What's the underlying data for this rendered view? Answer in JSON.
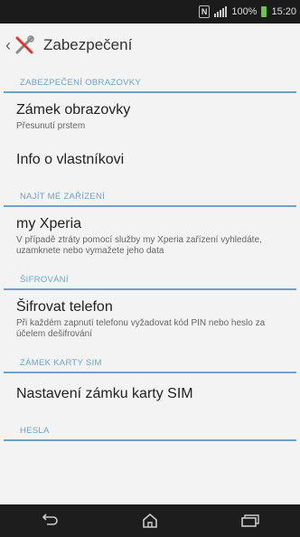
{
  "status_bar": {
    "nfc": "N",
    "battery": "100%",
    "time": "15:20"
  },
  "action_bar": {
    "title": "Zabezpečení",
    "back_icon": "chevron-left-icon",
    "app_icon": "security-tools-icon"
  },
  "sections": [
    {
      "header": "ZABEZPEČENÍ OBRAZOVKY",
      "items": [
        {
          "title": "Zámek obrazovky",
          "subtitle": "Přesunutí prstem"
        },
        {
          "title": "Info o vlastníkovi",
          "subtitle": ""
        }
      ]
    },
    {
      "header": "NAJÍT MÉ ZAŘÍZENÍ",
      "items": [
        {
          "title": "my Xperia",
          "subtitle": "V případě ztráty pomocí služby my Xperia zařízení vyhledáte, uzamknete nebo vymažete jeho data"
        }
      ]
    },
    {
      "header": "ŠIFROVÁNÍ",
      "items": [
        {
          "title": "Šifrovat telefon",
          "subtitle": "Při každém zapnutí telefonu vyžadovat kód PIN nebo heslo za účelem dešifrování"
        }
      ]
    },
    {
      "header": "ZÁMEK KARTY SIM",
      "items": [
        {
          "title": "Nastavení zámku karty SIM",
          "subtitle": ""
        }
      ]
    },
    {
      "header": "HESLA",
      "items": []
    }
  ],
  "nav_bar": {
    "back": "back-icon",
    "home": "home-icon",
    "recents": "recent-apps-icon"
  },
  "colors": {
    "accent": "#6ea3c6",
    "status_bar": "#1b1b1b",
    "nav_bar": "#1d1d1d",
    "background": "#f3f3f3"
  }
}
